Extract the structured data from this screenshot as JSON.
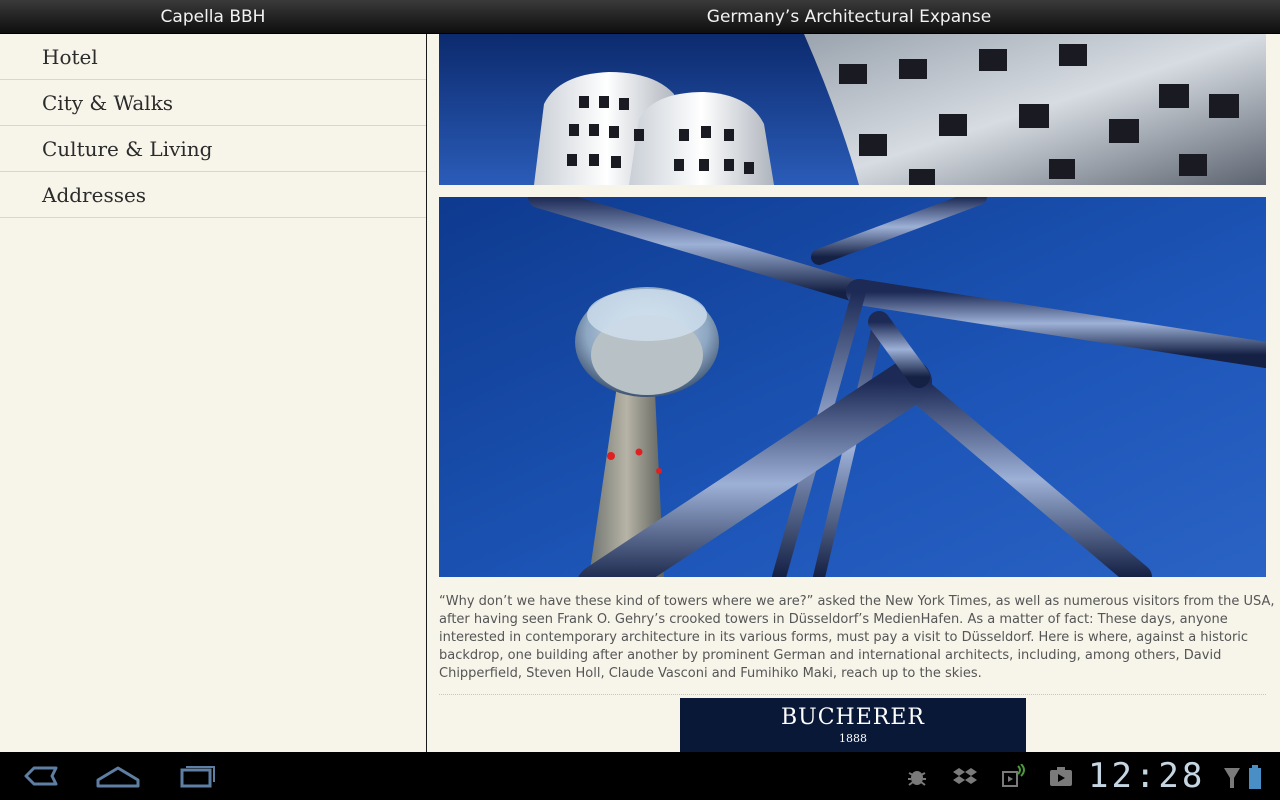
{
  "actionbar": {
    "app_title": "Capella BBH",
    "article_title": "Germany’s Architectural Expanse"
  },
  "sidebar": {
    "items": [
      {
        "label": "Hotel"
      },
      {
        "label": "City & Walks"
      },
      {
        "label": "Culture & Living"
      },
      {
        "label": "Addresses"
      }
    ]
  },
  "article": {
    "body": "“Why don’t we have these kind of towers where we are?” asked the New York Times, as well as numerous visitors from the USA, after having seen Frank O. Gehry’s crooked towers in Düsseldorf’s MedienHafen. As a matter of fact: These days, anyone interested in contemporary architecture in its various forms, must pay a visit to Düsseldorf. Here is where, against a historic backdrop, one building after another by prominent German and international architects, including, among others, David Chipperfield, Steven Holl, Claude Vasconi and Fumihiko Maki, reach up to the skies."
  },
  "ad": {
    "brand": "BUCHERER",
    "year": "1888"
  },
  "system": {
    "clock": "12:28",
    "icons": [
      "back-icon",
      "home-icon",
      "recent-apps-icon",
      "debug-icon",
      "dropbox-icon",
      "sync-icon",
      "media-icon",
      "wifi-signal-icon",
      "battery-icon"
    ]
  },
  "colors": {
    "pane_bg": "#f7f4ea",
    "actionbar_bg": "#1e1e1e",
    "ad_bg": "#0a1838",
    "sky_blue": "#1d4fa8",
    "clock": "#c5d6e3"
  }
}
